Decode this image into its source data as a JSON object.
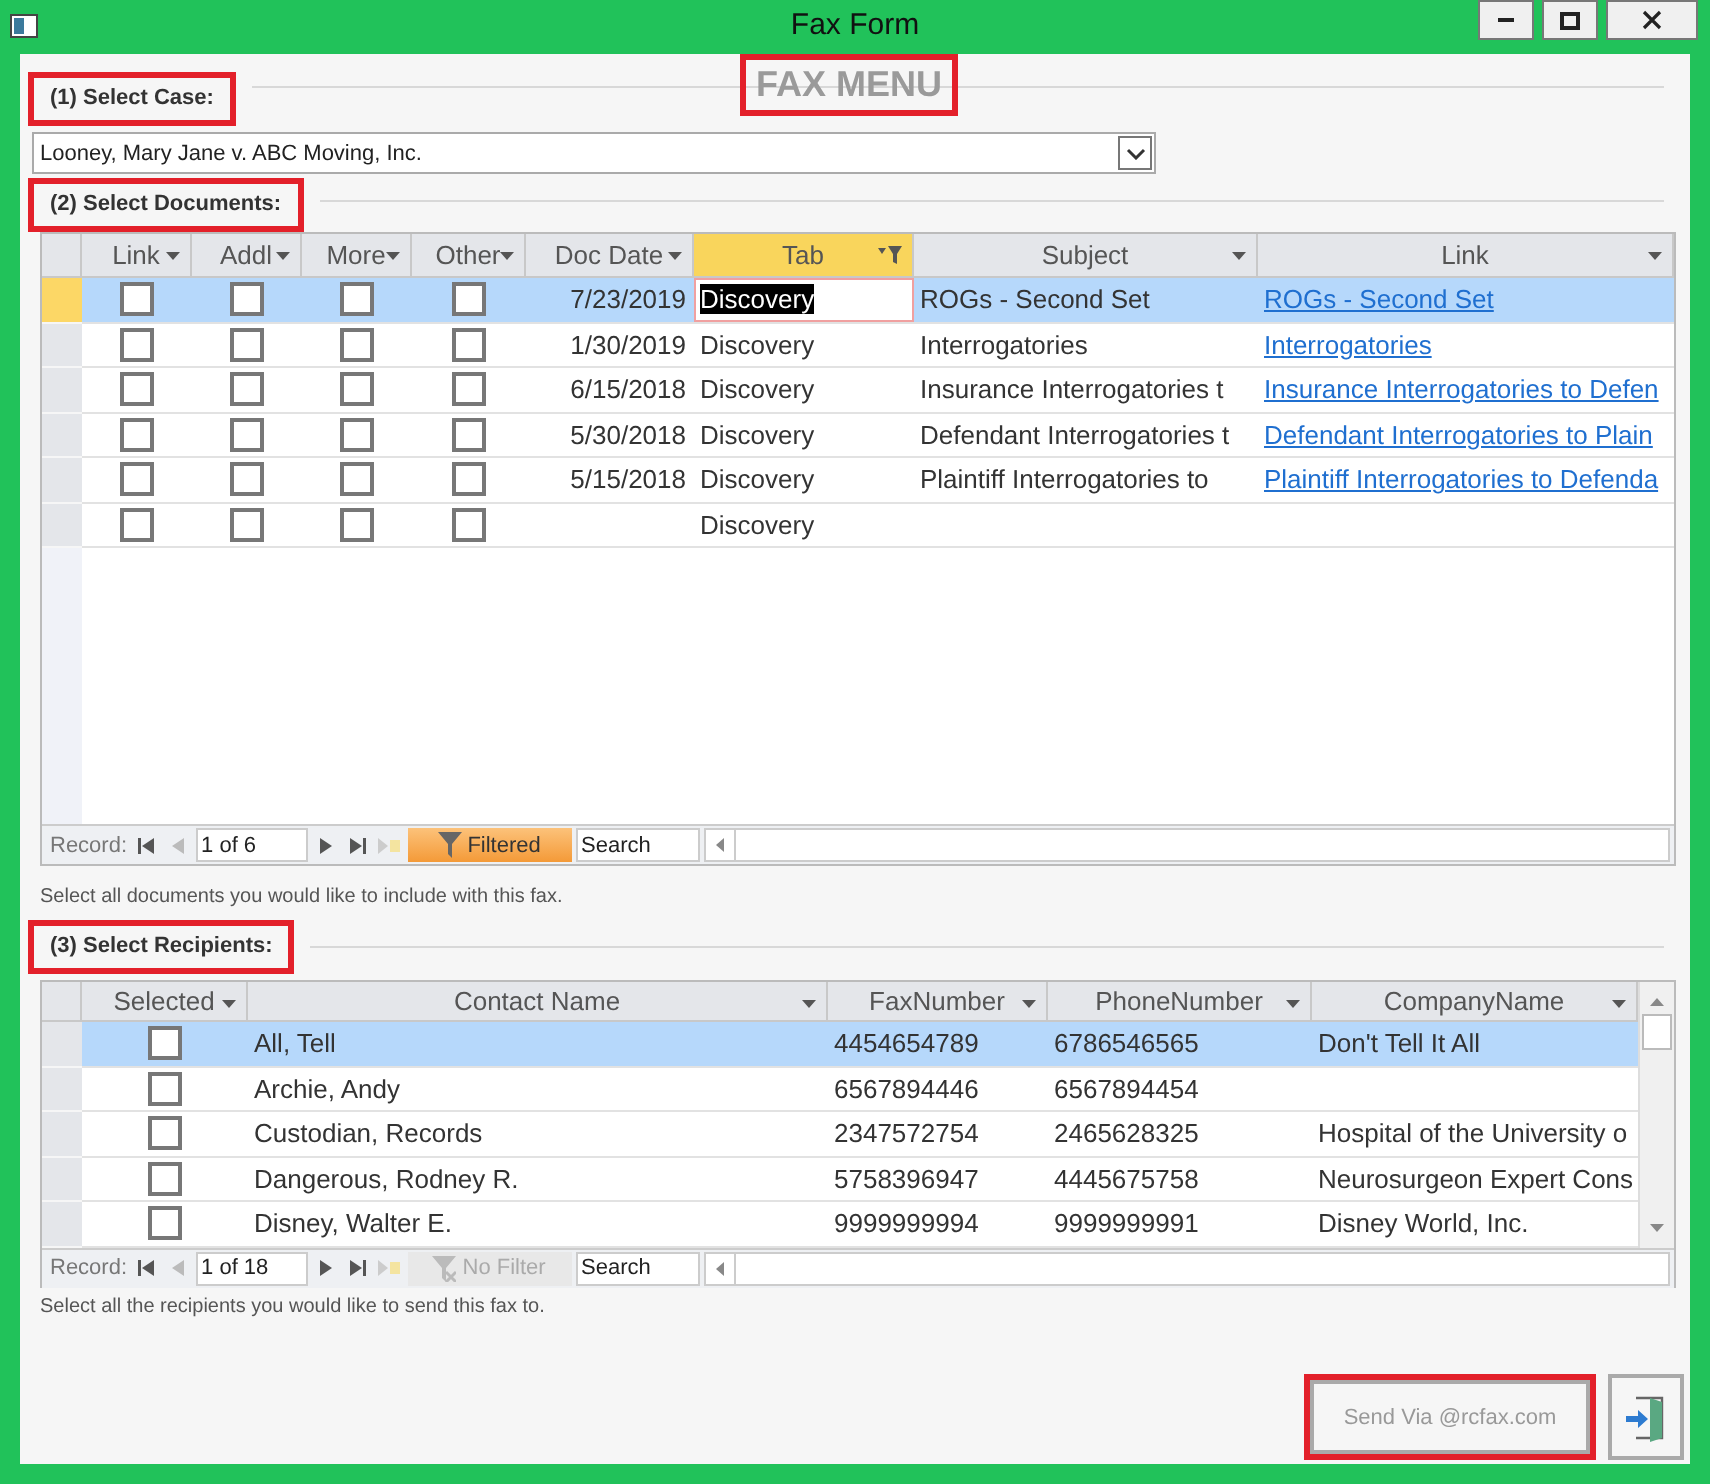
{
  "window": {
    "title": "Fax Form"
  },
  "heading": {
    "text": "FAX MENU",
    "highlighted": true
  },
  "case_section": {
    "label": "(1) Select Case:",
    "highlighted": true,
    "value": "Looney, Mary Jane v. ABC Moving, Inc."
  },
  "documents": {
    "label": "(2) Select Documents:",
    "highlighted": true,
    "columns": [
      {
        "label": "Link",
        "active": false,
        "filtered": false
      },
      {
        "label": "Addl",
        "active": false,
        "filtered": false
      },
      {
        "label": "More",
        "active": false,
        "filtered": false
      },
      {
        "label": "Other",
        "active": false,
        "filtered": false
      },
      {
        "label": "Doc Date",
        "active": false,
        "filtered": false
      },
      {
        "label": "Tab",
        "active": true,
        "filtered": true
      },
      {
        "label": "Subject",
        "active": false,
        "filtered": false
      },
      {
        "label": "Link",
        "active": false,
        "filtered": false
      }
    ],
    "rows": [
      {
        "selected": true,
        "editing": true,
        "checks": [
          false,
          false,
          false,
          false
        ],
        "doc_date": "7/23/2019",
        "tab": "Discovery",
        "subject": "ROGs - Second Set",
        "link": "ROGs - Second Set"
      },
      {
        "selected": false,
        "editing": false,
        "checks": [
          false,
          false,
          false,
          false
        ],
        "doc_date": "1/30/2019",
        "tab": "Discovery",
        "subject": "Interrogatories",
        "link": "Interrogatories"
      },
      {
        "selected": false,
        "editing": false,
        "checks": [
          false,
          false,
          false,
          false
        ],
        "doc_date": "6/15/2018",
        "tab": "Discovery",
        "subject": "Insurance Interrogatories t",
        "link": "Insurance Interrogatories to Defen"
      },
      {
        "selected": false,
        "editing": false,
        "checks": [
          false,
          false,
          false,
          false
        ],
        "doc_date": "5/30/2018",
        "tab": "Discovery",
        "subject": "Defendant Interrogatories t",
        "link": "Defendant Interrogatories to Plain"
      },
      {
        "selected": false,
        "editing": false,
        "checks": [
          false,
          false,
          false,
          false
        ],
        "doc_date": "5/15/2018",
        "tab": "Discovery",
        "subject": "Plaintiff Interrogatories to",
        "link": "Plaintiff Interrogatories to Defenda"
      },
      {
        "selected": false,
        "editing": false,
        "checks": [
          false,
          false,
          false,
          false
        ],
        "doc_date": "",
        "tab": "Discovery",
        "subject": "",
        "link": ""
      }
    ],
    "navigator": {
      "record_label": "Record:",
      "position": "1 of 6",
      "filter": "Filtered",
      "filter_on": true,
      "search": "Search"
    },
    "hint": "Select all documents you would like to include with this fax."
  },
  "recipients": {
    "label": "(3) Select Recipients:",
    "highlighted": true,
    "columns": [
      {
        "label": "Selected"
      },
      {
        "label": "Contact Name"
      },
      {
        "label": "FaxNumber"
      },
      {
        "label": "PhoneNumber"
      },
      {
        "label": "CompanyName"
      }
    ],
    "rows": [
      {
        "selected": true,
        "checked": false,
        "contact": "All, Tell",
        "fax": "4454654789",
        "phone": "6786546565",
        "company": "Don't Tell It All"
      },
      {
        "selected": false,
        "checked": false,
        "contact": "Archie, Andy",
        "fax": "6567894446",
        "phone": "6567894454",
        "company": ""
      },
      {
        "selected": false,
        "checked": false,
        "contact": "Custodian, Records",
        "fax": "2347572754",
        "phone": "2465628325",
        "company": "Hospital of the University o"
      },
      {
        "selected": false,
        "checked": false,
        "contact": "Dangerous, Rodney R.",
        "fax": "5758396947",
        "phone": "4445675758",
        "company": "Neurosurgeon Expert Cons"
      },
      {
        "selected": false,
        "checked": false,
        "contact": "Disney, Walter E.",
        "fax": "9999999994",
        "phone": "9999999991",
        "company": "Disney World, Inc."
      }
    ],
    "navigator": {
      "record_label": "Record:",
      "position": "1 of 18",
      "filter": "No Filter",
      "filter_on": false,
      "search": "Search"
    },
    "hint": "Select all the recipients you would like to send this fax to."
  },
  "send_button": {
    "label": "Send Via @rcfax.com",
    "highlighted": true
  }
}
